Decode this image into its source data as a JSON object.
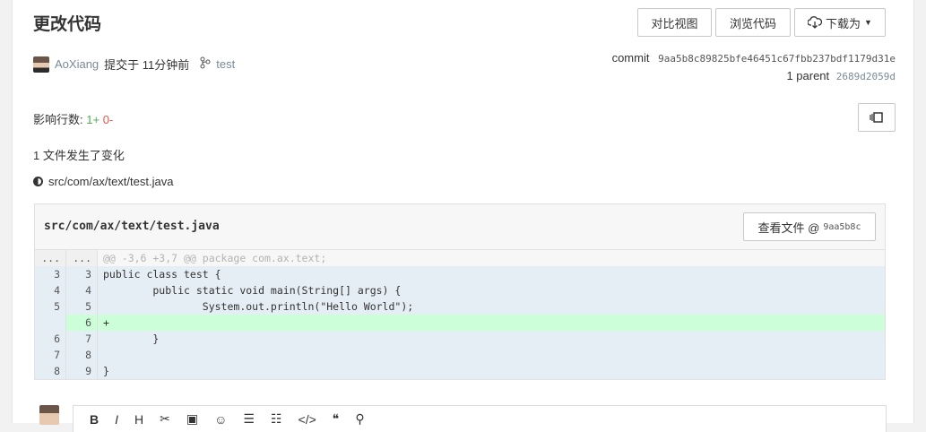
{
  "header": {
    "title": "更改代码",
    "compare_view": "对比视图",
    "browse_code": "浏览代码",
    "download_as": "下载为"
  },
  "meta": {
    "author": "AoXiang",
    "submitted": "提交于 11分钟前",
    "branch": "test",
    "commit_label": "commit",
    "commit_hash": "9aa5b8c89825bfe46451c67fbb237bdf1179d31e",
    "parent_label": "1 parent",
    "parent_hash": "2689d2059d"
  },
  "stats": {
    "affected_label": "影响行数:",
    "additions": "1+",
    "deletions": "0-",
    "files_changed": "1 文件发生了变化",
    "file_path": "src/com/ax/text/test.java"
  },
  "diff": {
    "file_name": "src/com/ax/text/test.java",
    "view_file_label": "查看文件 @",
    "view_file_hash": "9aa5b8c",
    "lines": [
      {
        "type": "hunk",
        "old": "...",
        "new": "...",
        "text": "@@ -3,6 +3,7 @@ package com.ax.text;"
      },
      {
        "type": "ctx",
        "old": "3",
        "new": "3",
        "text": "public class test {"
      },
      {
        "type": "ctx",
        "old": "4",
        "new": "4",
        "text": "        public static void main(String[] args) {"
      },
      {
        "type": "ctx",
        "old": "5",
        "new": "5",
        "text": "                System.out.println(\"Hello World\");"
      },
      {
        "type": "add",
        "old": "",
        "new": "6",
        "text": "+"
      },
      {
        "type": "ctx",
        "old": "6",
        "new": "7",
        "text": "        }"
      },
      {
        "type": "ctx",
        "old": "7",
        "new": "8",
        "text": ""
      },
      {
        "type": "ctx",
        "old": "8",
        "new": "9",
        "text": "}"
      }
    ]
  },
  "editor": {
    "tools": [
      "B",
      "I",
      "H",
      "✂",
      "▣",
      "☺",
      "☰",
      "☷",
      "</>",
      "❝",
      "⚲"
    ]
  },
  "colors": {
    "add": "#4caf50",
    "del": "#e5534b",
    "add_bg": "#ccffd8",
    "ctx_bg": "#e6eef5"
  }
}
